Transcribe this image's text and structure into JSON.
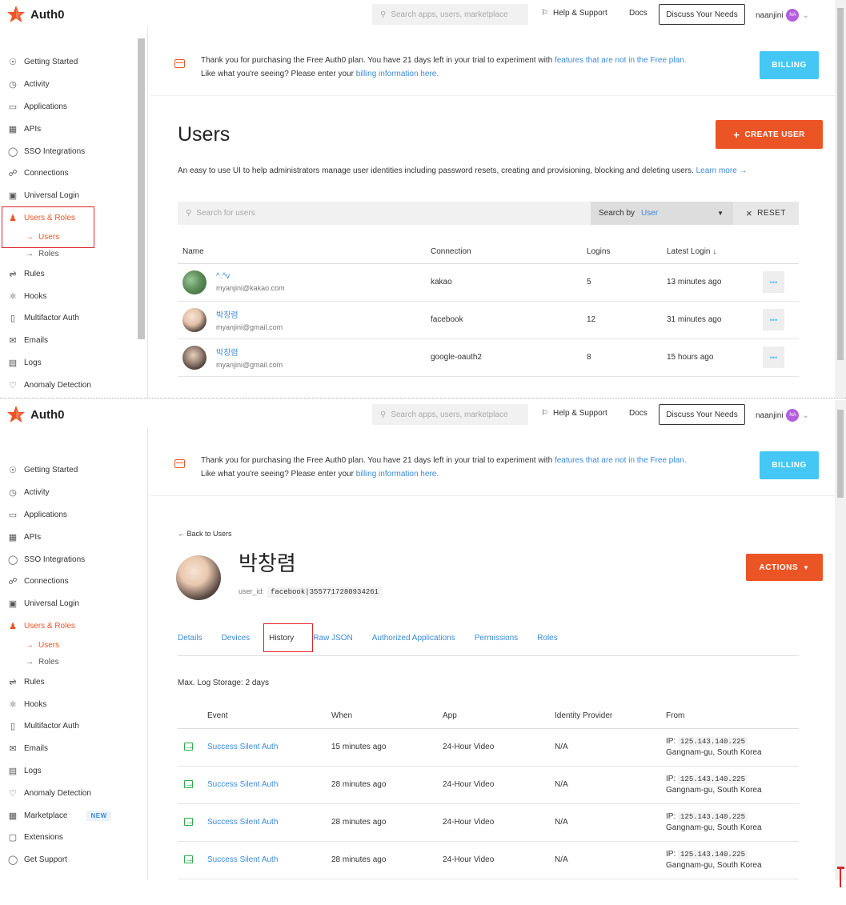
{
  "brand": {
    "name": "Auth0"
  },
  "topbar": {
    "search_placeholder": "Search apps, users, marketplace",
    "help": "Help & Support",
    "docs": "Docs",
    "discuss": "Discuss Your Needs",
    "username": "naanjini",
    "avatar_initials": "NA"
  },
  "sidebar1": {
    "items": [
      "Getting Started",
      "Activity",
      "Applications",
      "APIs",
      "SSO Integrations",
      "Connections",
      "Universal Login",
      "Users & Roles"
    ],
    "subitems": [
      "Users",
      "Roles"
    ],
    "items_after": [
      "Rules",
      "Hooks",
      "Multifactor Auth",
      "Emails",
      "Logs",
      "Anomaly Detection"
    ]
  },
  "sidebar2": {
    "items": [
      "Getting Started",
      "Activity",
      "Applications",
      "APIs",
      "SSO Integrations",
      "Connections",
      "Universal Login",
      "Users & Roles"
    ],
    "subitems": [
      "Users",
      "Roles"
    ],
    "items_after": [
      "Rules",
      "Hooks",
      "Multifactor Auth",
      "Emails",
      "Logs",
      "Anomaly Detection",
      "Marketplace",
      "Extensions",
      "Get Support"
    ],
    "marketplace_badge": "NEW"
  },
  "banner": {
    "line1_a": "Thank you for purchasing the Free Auth0 plan. You have 21 days left in your trial to experiment with ",
    "line1_link": "features that are not in the Free plan.",
    "line2_a": "Like what you're seeing? Please enter your ",
    "line2_link": "billing information here.",
    "billing_button": "BILLING"
  },
  "users_page": {
    "title": "Users",
    "create_button": "CREATE USER",
    "description": "An easy to use UI to help administrators manage user identities including password resets, creating and provisioning, blocking and deleting users.",
    "learn_more": "Learn more",
    "search_placeholder": "Search for users",
    "search_by_label": "Search by",
    "search_by_value": "User",
    "reset_button": "RESET",
    "columns": [
      "Name",
      "Connection",
      "Logins",
      "Latest Login"
    ],
    "rows": [
      {
        "name": "^.^v",
        "email": "myanjini@kakao.com",
        "connection": "kakao",
        "logins": "5",
        "latest": "13 minutes ago"
      },
      {
        "name": "박창렴",
        "email": "myanjini@gmail.com",
        "connection": "facebook",
        "logins": "12",
        "latest": "31 minutes ago"
      },
      {
        "name": "박창렴",
        "email": "myanjini@gmail.com",
        "connection": "google-oauth2",
        "logins": "8",
        "latest": "15 hours ago"
      }
    ]
  },
  "user_detail": {
    "back_link": "Back to Users",
    "name": "박창렴",
    "user_id_label": "user_id:",
    "user_id": "facebook|3557717280934261",
    "actions_button": "ACTIONS",
    "tabs": [
      "Details",
      "Devices",
      "History",
      "Raw JSON",
      "Authorized Applications",
      "Permissions",
      "Roles"
    ],
    "selected_tab": "History",
    "max_log": "Max. Log Storage: 2 days",
    "columns": [
      "Event",
      "When",
      "App",
      "Identity Provider",
      "From"
    ],
    "rows": [
      {
        "event": "Success Silent Auth",
        "when": "15 minutes ago",
        "app": "24-Hour Video",
        "idp": "N/A",
        "ip_label": "IP:",
        "ip": "125.143.140.225",
        "location": "Gangnam-gu, South Korea"
      },
      {
        "event": "Success Silent Auth",
        "when": "28 minutes ago",
        "app": "24-Hour Video",
        "idp": "N/A",
        "ip_label": "IP:",
        "ip": "125.143.140.225",
        "location": "Gangnam-gu, South Korea"
      },
      {
        "event": "Success Silent Auth",
        "when": "28 minutes ago",
        "app": "24-Hour Video",
        "idp": "N/A",
        "ip_label": "IP:",
        "ip": "125.143.140.225",
        "location": "Gangnam-gu, South Korea"
      },
      {
        "event": "Success Silent Auth",
        "when": "28 minutes ago",
        "app": "24-Hour Video",
        "idp": "N/A",
        "ip_label": "IP:",
        "ip": "125.143.140.225",
        "location": "Gangnam-gu, South Korea"
      }
    ]
  },
  "colors": {
    "accent": "#eb5424",
    "link": "#3c8ad8",
    "billing": "#44c7f4",
    "highlight_box": "#e0242b"
  }
}
